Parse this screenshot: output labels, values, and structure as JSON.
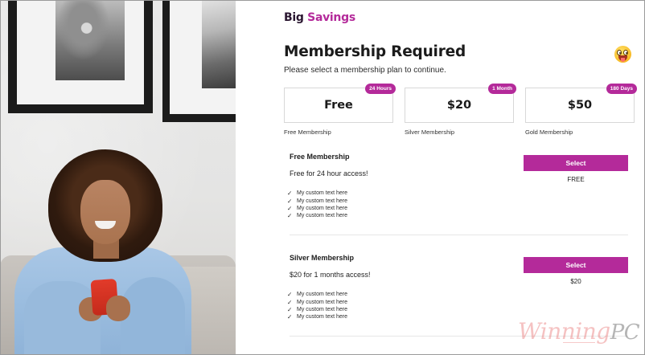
{
  "brand": {
    "part1": "Big",
    "part2": "Savings"
  },
  "header": {
    "title": "Membership Required",
    "subtitle": "Please select a membership plan to continue.",
    "emoji_icon": "grinning-face-with-tongue-icon"
  },
  "plans": [
    {
      "price": "Free",
      "badge": "24 Hours",
      "name": "Free Membership"
    },
    {
      "price": "$20",
      "badge": "1 Month",
      "name": "Silver Membership"
    },
    {
      "price": "$50",
      "badge": "180 Days",
      "name": "Gold Membership"
    }
  ],
  "details": [
    {
      "title": "Free Membership",
      "description": "Free for 24 hour access!",
      "features": [
        "My custom text here",
        "My custom text here",
        "My custom text here",
        "My custom text here"
      ],
      "button_label": "Select",
      "price_label": "FREE"
    },
    {
      "title": "Silver Membership",
      "description": "$20 for 1 months access!",
      "features": [
        "My custom text here",
        "My custom text here",
        "My custom text here",
        "My custom text here"
      ],
      "button_label": "Select",
      "price_label": "$20"
    }
  ],
  "watermark": {
    "part1": "Winning",
    "part2": "PC"
  },
  "colors": {
    "accent": "#b42a9a",
    "brand_dark": "#2a1630",
    "border": "#d8d8d8"
  }
}
